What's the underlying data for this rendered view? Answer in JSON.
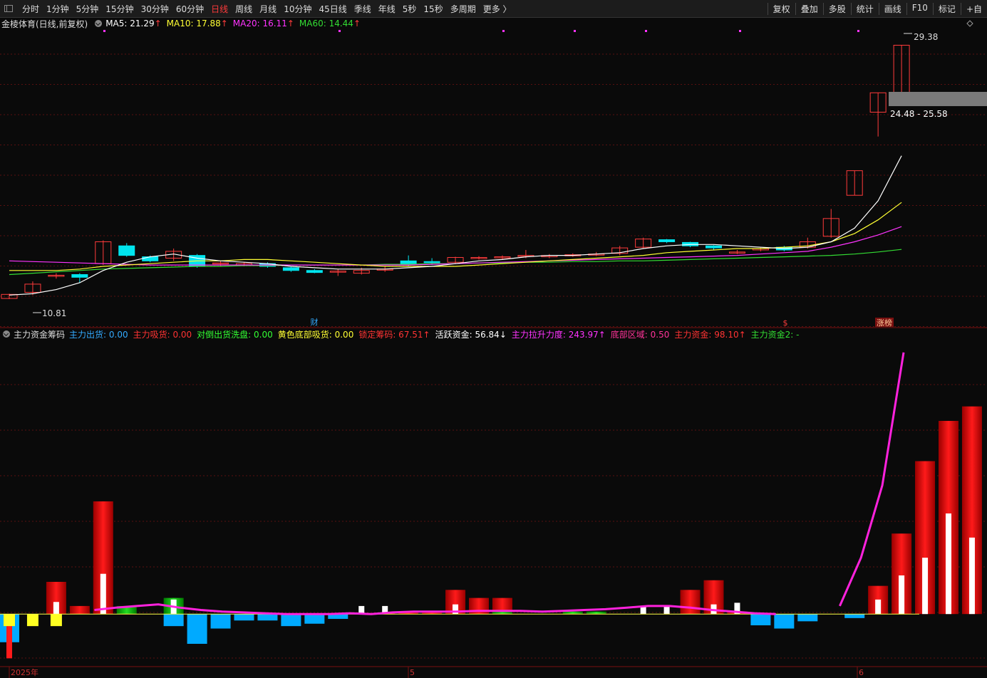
{
  "toolbar": {
    "periods": [
      "分时",
      "1分钟",
      "5分钟",
      "15分钟",
      "30分钟",
      "60分钟",
      "日线",
      "周线",
      "月线",
      "10分钟",
      "45日线",
      "季线",
      "年线",
      "5秒",
      "15秒",
      "多周期",
      "更多 〉"
    ],
    "active": "日线",
    "right": [
      "复权",
      "叠加",
      "多股",
      "统计",
      "画线",
      "F10",
      "标记",
      "+自"
    ]
  },
  "main_legend": {
    "title": "金棱体育(日线,前复权)",
    "ma": [
      {
        "label": "MA5: 21.29",
        "color": "#ffffff"
      },
      {
        "label": "MA10: 17.88",
        "color": "#ffff33"
      },
      {
        "label": "MA20: 16.11",
        "color": "#ff33ff"
      },
      {
        "label": "MA60: 14.44",
        "color": "#33dd33"
      }
    ],
    "up_arrow": "↑"
  },
  "sub_legend": {
    "title": "主力资金筹码",
    "items": [
      {
        "label": "主力出货: 0.00",
        "color": "#33aaff"
      },
      {
        "label": "主力吸货: 0.00",
        "color": "#ff3333"
      },
      {
        "label": "对倒出货洗盘: 0.00",
        "color": "#33ff33"
      },
      {
        "label": "黄色底部吸货: 0.00",
        "color": "#ffff33"
      },
      {
        "label": "锁定筹码: 67.51↑",
        "color": "#ff3333"
      },
      {
        "label": "活跃资金: 56.84↓",
        "color": "#ffffff"
      },
      {
        "label": "主力拉升力度: 243.97↑",
        "color": "#ff33ff"
      },
      {
        "label": "底部区域: 0.50",
        "color": "#ff3399"
      },
      {
        "label": "主力资金: 98.10↑",
        "color": "#ff3333"
      },
      {
        "label": "主力资金2: -",
        "color": "#33dd33"
      }
    ]
  },
  "annotations": {
    "high_label": "29.38",
    "low_label": "10.81",
    "range_label": "24.48 - 25.58",
    "cai_marker": "财",
    "dollar_marker": "$",
    "zt_marker": "涨榜"
  },
  "x_axis": {
    "labels": [
      "2025年",
      "5",
      "6"
    ]
  },
  "colors": {
    "up": "#ff3b3b",
    "down": "#00e5ee",
    "grid": "#5a1010"
  },
  "chart_data": {
    "type": "candlestick",
    "ylim": [
      9.5,
      30.5
    ],
    "candles": [
      {
        "o": 10.85,
        "c": 11.15,
        "h": 11.2,
        "l": 10.81
      },
      {
        "o": 11.3,
        "c": 11.9,
        "h": 12.1,
        "l": 11.1
      },
      {
        "o": 12.5,
        "c": 12.55,
        "h": 12.7,
        "l": 12.3
      },
      {
        "o": 12.6,
        "c": 12.4,
        "h": 12.7,
        "l": 12.0
      },
      {
        "o": 13.4,
        "c": 15.0,
        "h": 15.1,
        "l": 13.3
      },
      {
        "o": 14.7,
        "c": 14.0,
        "h": 14.9,
        "l": 13.9
      },
      {
        "o": 13.9,
        "c": 13.6,
        "h": 14.0,
        "l": 13.5
      },
      {
        "o": 13.8,
        "c": 14.3,
        "h": 14.5,
        "l": 13.6
      },
      {
        "o": 14.0,
        "c": 13.2,
        "h": 14.1,
        "l": 13.1
      },
      {
        "o": 13.4,
        "c": 13.45,
        "h": 13.6,
        "l": 13.2
      },
      {
        "o": 13.3,
        "c": 13.4,
        "h": 13.5,
        "l": 13.2
      },
      {
        "o": 13.4,
        "c": 13.2,
        "h": 13.5,
        "l": 13.1
      },
      {
        "o": 13.1,
        "c": 12.9,
        "h": 13.2,
        "l": 12.8
      },
      {
        "o": 12.9,
        "c": 12.75,
        "h": 13.0,
        "l": 12.7
      },
      {
        "o": 12.8,
        "c": 12.85,
        "h": 13.0,
        "l": 12.5
      },
      {
        "o": 12.7,
        "c": 12.9,
        "h": 13.1,
        "l": 12.6
      },
      {
        "o": 13.0,
        "c": 13.0,
        "h": 13.2,
        "l": 12.8
      },
      {
        "o": 13.6,
        "c": 13.4,
        "h": 14.0,
        "l": 13.2
      },
      {
        "o": 13.55,
        "c": 13.5,
        "h": 13.8,
        "l": 13.3
      },
      {
        "o": 13.5,
        "c": 13.85,
        "h": 13.9,
        "l": 13.4
      },
      {
        "o": 13.85,
        "c": 13.85,
        "h": 13.95,
        "l": 13.7
      },
      {
        "o": 13.9,
        "c": 13.9,
        "h": 14.0,
        "l": 13.7
      },
      {
        "o": 14.0,
        "c": 14.0,
        "h": 14.4,
        "l": 13.8
      },
      {
        "o": 13.9,
        "c": 14.0,
        "h": 14.1,
        "l": 13.8
      },
      {
        "o": 14.0,
        "c": 14.05,
        "h": 14.15,
        "l": 13.9
      },
      {
        "o": 14.1,
        "c": 14.1,
        "h": 14.25,
        "l": 13.95
      },
      {
        "o": 14.15,
        "c": 14.55,
        "h": 14.7,
        "l": 14.0
      },
      {
        "o": 14.6,
        "c": 15.2,
        "h": 15.3,
        "l": 14.5
      },
      {
        "o": 15.15,
        "c": 15.0,
        "h": 15.2,
        "l": 14.9
      },
      {
        "o": 14.95,
        "c": 14.7,
        "h": 15.0,
        "l": 14.6
      },
      {
        "o": 14.7,
        "c": 14.55,
        "h": 14.75,
        "l": 14.4
      },
      {
        "o": 14.2,
        "c": 14.25,
        "h": 14.4,
        "l": 14.1
      },
      {
        "o": 14.4,
        "c": 14.5,
        "h": 14.6,
        "l": 14.3
      },
      {
        "o": 14.6,
        "c": 14.4,
        "h": 14.7,
        "l": 14.3
      },
      {
        "o": 14.6,
        "c": 15.0,
        "h": 15.3,
        "l": 14.5
      },
      {
        "o": 15.4,
        "c": 16.7,
        "h": 17.4,
        "l": 15.3
      },
      {
        "o": 18.4,
        "c": 20.2,
        "h": 20.2,
        "l": 18.4
      },
      {
        "o": 24.48,
        "c": 25.9,
        "h": 25.9,
        "l": 22.7
      },
      {
        "o": 25.58,
        "c": 29.38,
        "h": 29.38,
        "l": 25.58
      }
    ],
    "ma5": [
      11.1,
      11.2,
      11.5,
      12.0,
      12.9,
      13.5,
      13.9,
      14.1,
      13.8,
      13.6,
      13.5,
      13.4,
      13.2,
      13.1,
      13.0,
      13.0,
      13.0,
      13.1,
      13.2,
      13.4,
      13.6,
      13.7,
      13.9,
      14.0,
      14.0,
      14.1,
      14.2,
      14.5,
      14.7,
      14.8,
      14.8,
      14.7,
      14.6,
      14.5,
      14.6,
      15.0,
      16.0,
      18.0,
      21.29
    ],
    "ma10": [
      12.9,
      12.9,
      12.9,
      13.0,
      13.2,
      13.3,
      13.4,
      13.5,
      13.6,
      13.6,
      13.7,
      13.7,
      13.6,
      13.5,
      13.4,
      13.3,
      13.2,
      13.2,
      13.2,
      13.2,
      13.3,
      13.4,
      13.5,
      13.6,
      13.7,
      13.8,
      13.9,
      14.0,
      14.2,
      14.3,
      14.4,
      14.5,
      14.5,
      14.6,
      14.7,
      15.0,
      15.6,
      16.6,
      17.88
    ],
    "ma20": [
      13.6,
      13.55,
      13.5,
      13.45,
      13.4,
      13.35,
      13.3,
      13.3,
      13.3,
      13.3,
      13.3,
      13.3,
      13.3,
      13.3,
      13.3,
      13.3,
      13.3,
      13.3,
      13.35,
      13.4,
      13.45,
      13.5,
      13.55,
      13.6,
      13.65,
      13.7,
      13.75,
      13.8,
      13.85,
      13.9,
      13.95,
      14.0,
      14.1,
      14.2,
      14.3,
      14.6,
      15.0,
      15.5,
      16.11
    ],
    "ma60": [
      12.6,
      12.7,
      12.8,
      12.9,
      13.0,
      13.05,
      13.1,
      13.15,
      13.2,
      13.2,
      13.25,
      13.25,
      13.3,
      13.3,
      13.3,
      13.3,
      13.35,
      13.35,
      13.4,
      13.4,
      13.45,
      13.45,
      13.5,
      13.5,
      13.55,
      13.55,
      13.6,
      13.6,
      13.65,
      13.7,
      13.75,
      13.8,
      13.85,
      13.9,
      13.95,
      14.0,
      14.1,
      14.25,
      14.44
    ],
    "sub": {
      "ylim": [
        -60,
        340
      ],
      "red": [
        0,
        0,
        40,
        10,
        140,
        0,
        0,
        0,
        0,
        0,
        0,
        0,
        0,
        0,
        0,
        0,
        1,
        2,
        3,
        30,
        20,
        20,
        0,
        0,
        0,
        0,
        0,
        0,
        0,
        30,
        42,
        3,
        0,
        0,
        0,
        0,
        0,
        35,
        100,
        190,
        240,
        258
      ],
      "cyan": [
        -35,
        0,
        0,
        0,
        0,
        0,
        0,
        -15,
        -37,
        -18,
        -8,
        -8,
        -15,
        -12,
        -6,
        0,
        0,
        0,
        0,
        0,
        0,
        0,
        0,
        0,
        0,
        0,
        0,
        0,
        0,
        0,
        0,
        0,
        -14,
        -18,
        -9,
        0,
        -5,
        0,
        0,
        0,
        0,
        0
      ],
      "green": [
        0,
        0,
        0,
        0,
        0,
        10,
        0,
        20,
        0,
        0,
        0,
        0,
        0,
        0,
        0,
        0,
        0,
        0,
        0,
        0,
        0,
        3,
        0,
        0,
        3,
        3,
        0,
        0,
        0,
        0,
        0,
        0,
        0,
        0,
        0,
        0,
        0,
        0,
        0,
        0,
        0,
        0
      ],
      "yellow": [
        -15,
        -15,
        -15,
        0,
        0,
        0,
        0,
        0,
        0,
        0,
        0,
        0,
        0,
        0,
        0,
        0,
        0,
        0,
        0,
        0,
        0,
        0,
        0,
        0,
        0,
        0,
        0,
        0,
        0,
        0,
        0,
        0,
        0,
        0,
        0,
        0,
        0,
        0,
        0,
        0,
        0,
        0
      ],
      "white": [
        0,
        0,
        15,
        0,
        50,
        0,
        0,
        18,
        0,
        0,
        0,
        0,
        0,
        0,
        0,
        10,
        10,
        0,
        0,
        12,
        0,
        0,
        0,
        0,
        0,
        0,
        0,
        10,
        10,
        0,
        12,
        14,
        0,
        0,
        0,
        0,
        0,
        18,
        48,
        70,
        125,
        95
      ],
      "magenta": [
        null,
        null,
        null,
        null,
        5,
        8,
        10,
        12,
        8,
        5,
        3,
        2,
        1,
        0,
        0,
        0,
        1,
        0,
        2,
        3,
        3,
        3,
        4,
        4,
        4,
        3,
        4,
        5,
        6,
        8,
        10,
        10,
        8,
        5,
        3,
        1,
        0,
        null,
        null,
        10,
        70,
        160,
        325
      ],
      "redneg": [
        -55,
        0,
        0,
        0,
        0,
        0,
        0,
        0,
        0,
        0,
        0,
        0,
        0,
        0,
        0,
        0,
        0,
        0,
        0,
        0,
        0,
        0,
        0,
        0,
        0,
        0,
        0,
        0,
        0,
        0,
        0,
        0,
        0,
        0,
        0,
        0,
        0,
        0,
        0,
        0,
        0,
        0
      ]
    }
  }
}
